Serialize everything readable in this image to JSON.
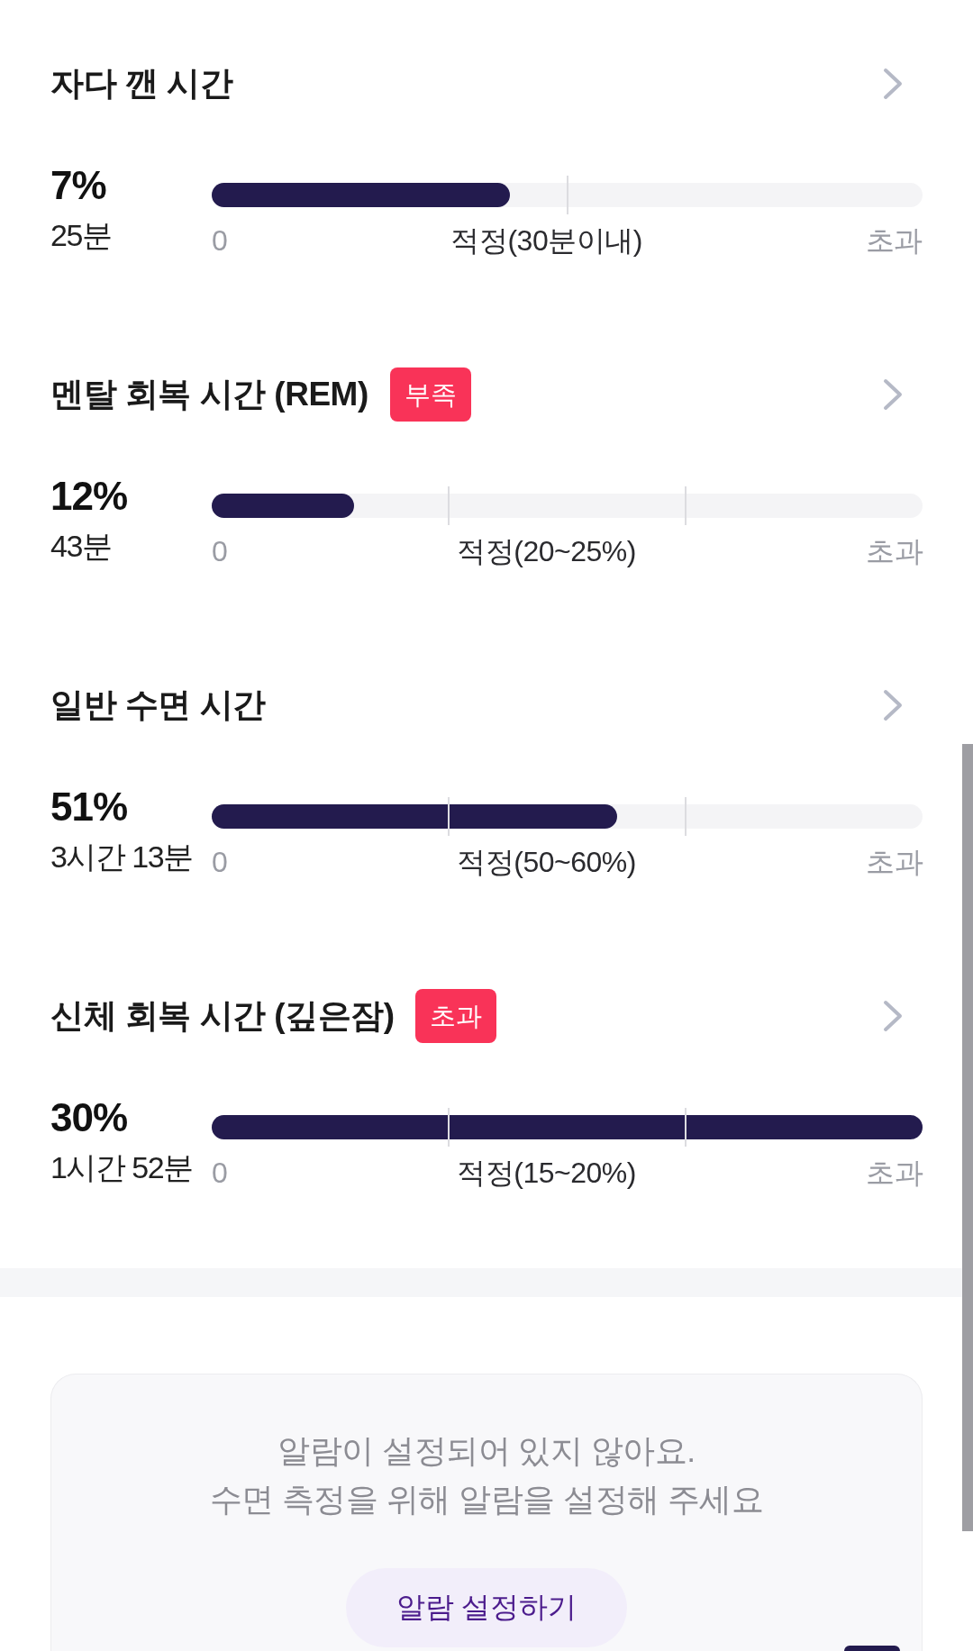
{
  "sections": [
    {
      "title": "자다 깬 시간",
      "percent": "7%",
      "duration": "25분",
      "bar": {
        "kind": "limit",
        "level": 0.42
      },
      "scale": {
        "start": "0",
        "middle": "적정(30분이내)",
        "end": "초과"
      }
    },
    {
      "title": "멘탈 회복 시간 (REM)",
      "badge": "부족",
      "percent": "12%",
      "duration": "43분",
      "bar": {
        "kind": "range",
        "level": 0.2
      },
      "scale": {
        "start": "0",
        "middle": "적정(20~25%)",
        "end": "초과"
      }
    },
    {
      "title": "일반 수면 시간",
      "percent": "51%",
      "duration": "3시간 13분",
      "bar": {
        "kind": "range",
        "level": 0.57
      },
      "scale": {
        "start": "0",
        "middle": "적정(50~60%)",
        "end": "초과"
      }
    },
    {
      "title": "신체 회복 시간 (깊은잠)",
      "badge": "초과",
      "percent": "30%",
      "duration": "1시간 52분",
      "bar": {
        "kind": "range",
        "level": 1
      },
      "scale": {
        "start": "0",
        "middle": "적정(15~20%)",
        "end": "초과"
      }
    }
  ],
  "alarm_notice": {
    "message": "알람이 설정되어 있지 않아요.\n수면 측정을 위해 알람을 설정해 주세요",
    "button": "알람 설정하기"
  }
}
